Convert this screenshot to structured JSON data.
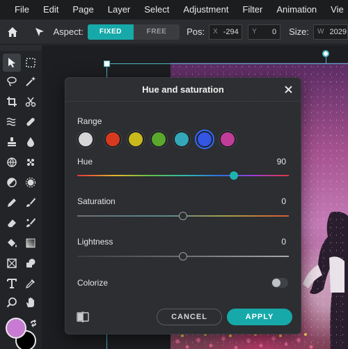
{
  "menu": [
    "File",
    "Edit",
    "Page",
    "Layer",
    "Select",
    "Adjustment",
    "Filter",
    "Animation",
    "Vie"
  ],
  "options": {
    "aspect_label": "Aspect:",
    "aspect_fixed": "FIXED",
    "aspect_free": "FREE",
    "pos_label": "Pos:",
    "pos_x_prefix": "X",
    "pos_x": "-294",
    "pos_y_prefix": "Y",
    "pos_y": "0",
    "size_label": "Size:",
    "size_w_prefix": "W",
    "size_w": "2029"
  },
  "dialog": {
    "title": "Hue and saturation",
    "range_label": "Range",
    "range_colors": [
      "#d6d6d6",
      "#d63a1e",
      "#c9b91c",
      "#5aa82c",
      "#34a8b8",
      "#3356e3",
      "#c23d9a"
    ],
    "range_selected": 5,
    "hue_label": "Hue",
    "hue_value": "90",
    "hue_level": 0.74,
    "saturation_label": "Saturation",
    "saturation_value": "0",
    "saturation_level": 0.5,
    "lightness_label": "Lightness",
    "lightness_value": "0",
    "lightness_level": 0.5,
    "colorize_label": "Colorize",
    "cancel_label": "CANCEL",
    "apply_label": "APPLY"
  },
  "colors": {
    "accent": "#17a9a9",
    "foreground": "#c77bd2",
    "background": "#000000"
  }
}
